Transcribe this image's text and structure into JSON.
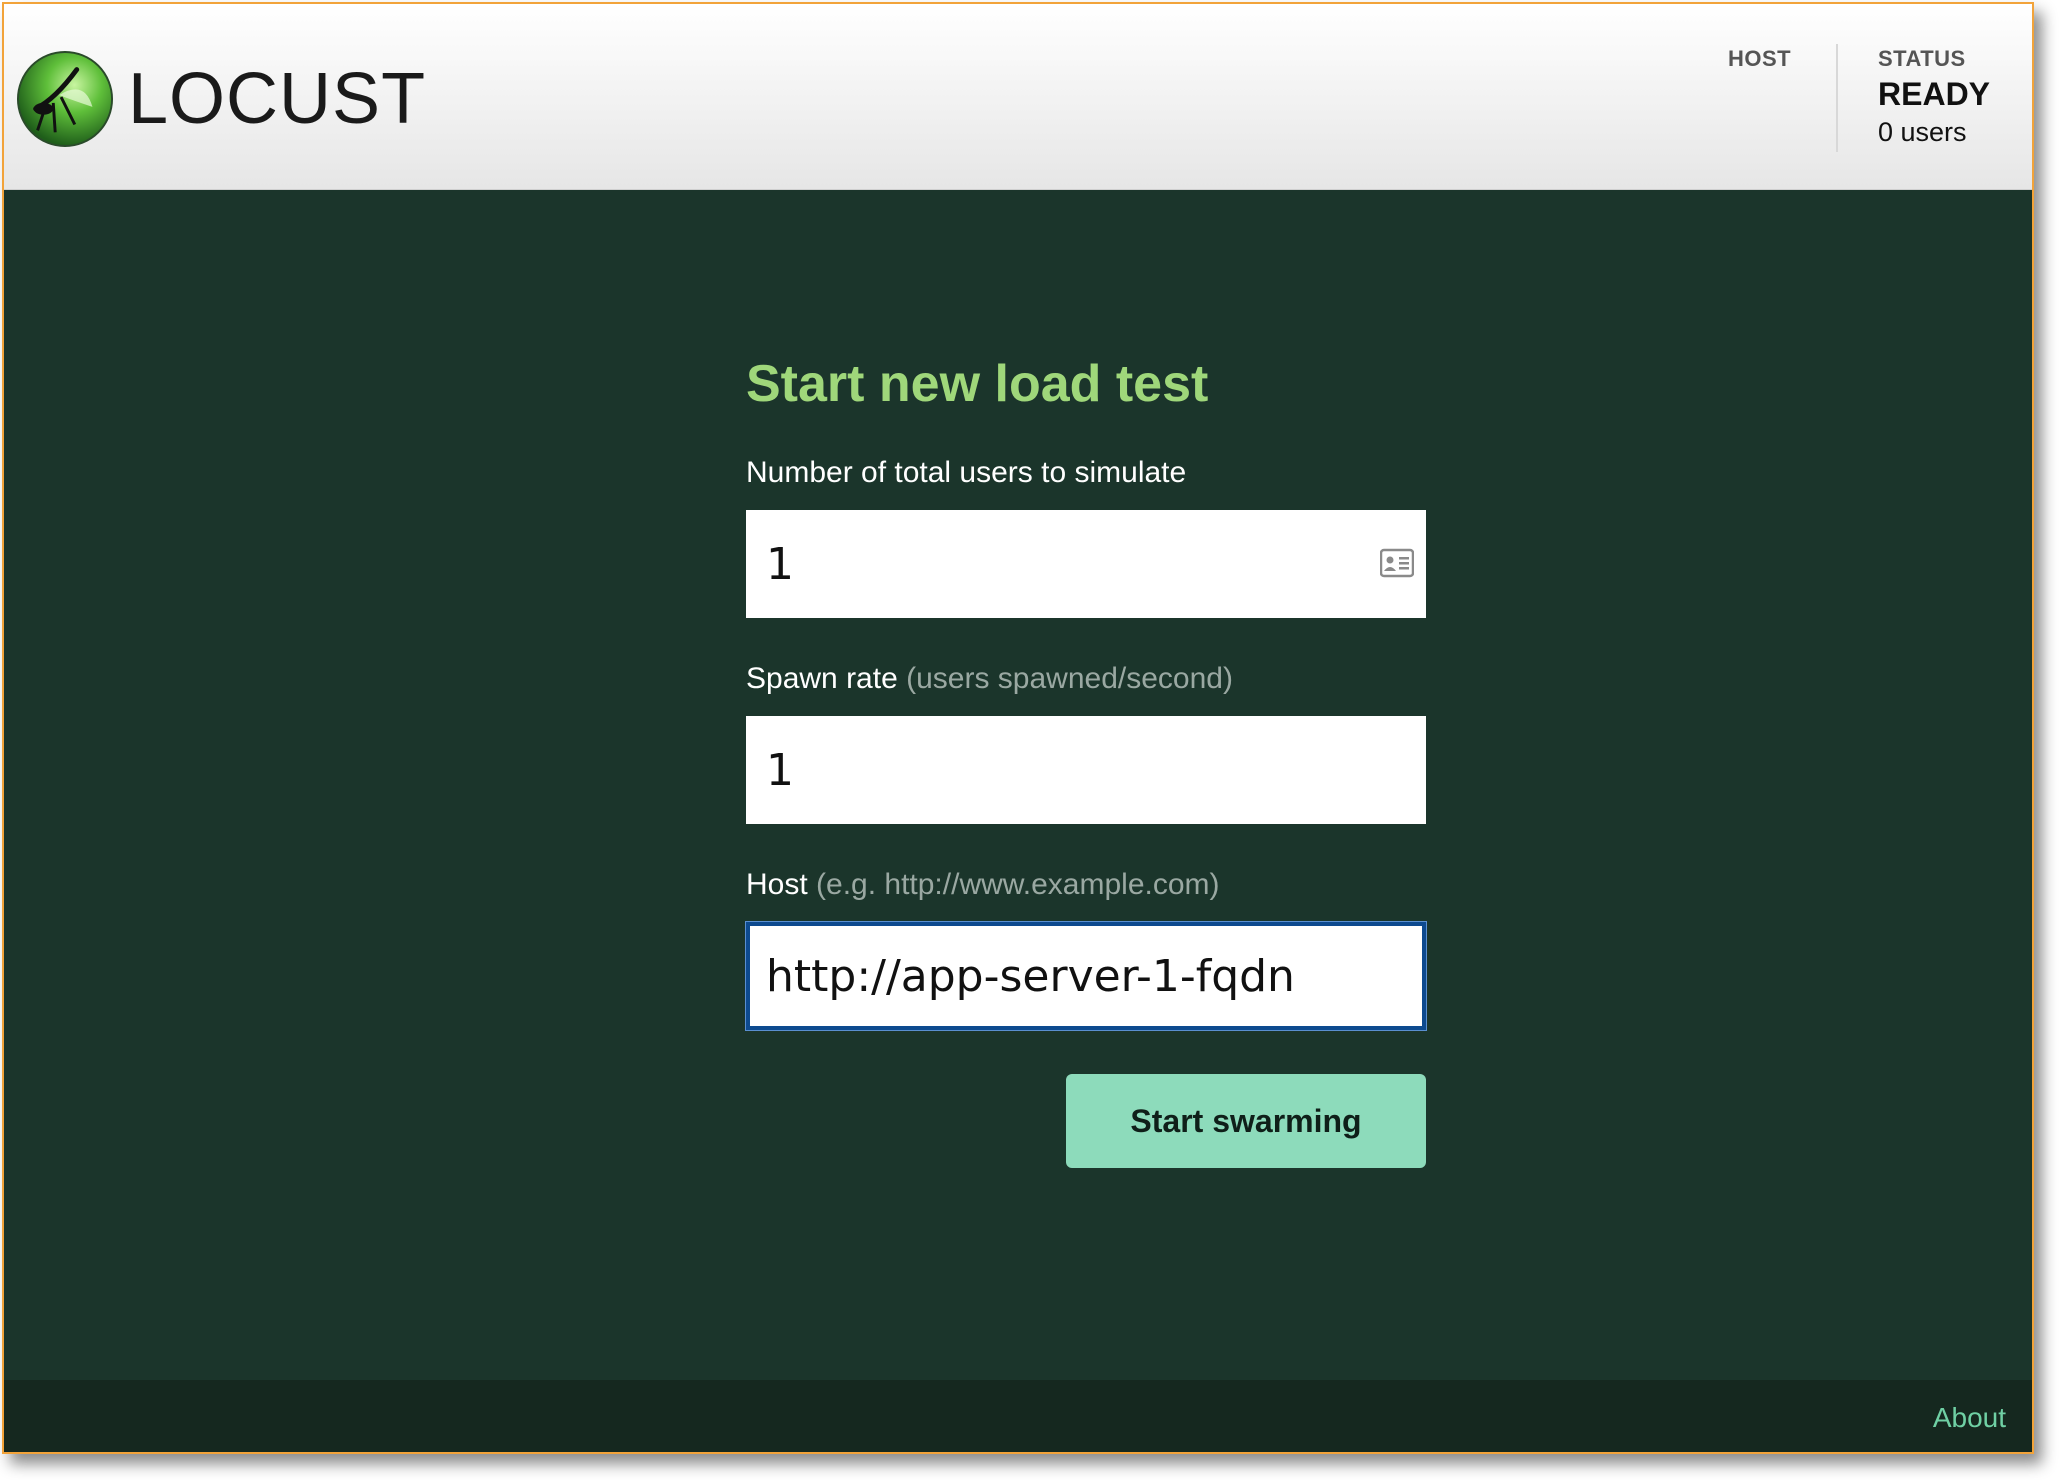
{
  "header": {
    "logo_text": "LOCUST",
    "host_label": "HOST",
    "status_label": "STATUS",
    "status_value": "READY",
    "users_text": "0 users"
  },
  "form": {
    "title": "Start new load test",
    "users": {
      "label": "Number of total users to simulate",
      "value": "1"
    },
    "spawn_rate": {
      "label": "Spawn rate",
      "hint": "(users spawned/second)",
      "value": "1"
    },
    "host": {
      "label": "Host",
      "hint": "(e.g. http://www.example.com)",
      "value": "http://app-server-1-fqdn"
    },
    "submit_label": "Start swarming"
  },
  "footer": {
    "about_label": "About"
  },
  "colors": {
    "background": "#1b352b",
    "title": "#9fd77a",
    "button": "#8ddbbb",
    "link": "#6fd0a4",
    "frame_border": "#f2a33a"
  }
}
